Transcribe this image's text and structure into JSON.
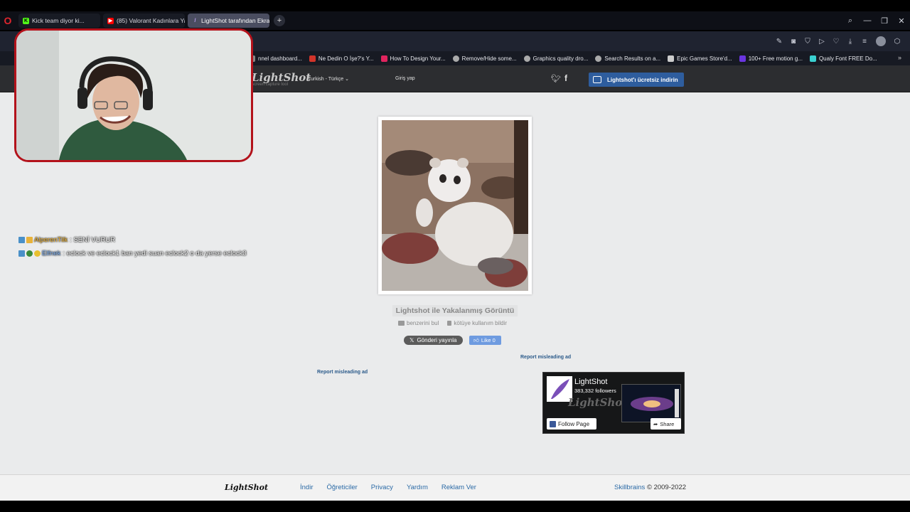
{
  "browser": {
    "tabs": [
      {
        "label": "Kick team diyor ki...",
        "icon": "kick-icon",
        "color": "#53fc18"
      },
      {
        "label": "(85) Valorant Kadınlara Ya...",
        "icon": "youtube-icon",
        "color": "#ff0000"
      },
      {
        "label": "LightShot tarafından Ekra...",
        "icon": "lightshot-feather-icon",
        "color": "#9b6cd9"
      }
    ],
    "bookmarks": [
      {
        "label": "nnel dashboard...",
        "color": "#888888"
      },
      {
        "label": "Ne Dedin O İşe?'s Y...",
        "color": "#d2342a"
      },
      {
        "label": "How To Design Your...",
        "color": "#e0245e"
      },
      {
        "label": "Remove/Hide some...",
        "color": "#aaaaaa"
      },
      {
        "label": "Graphics quality dro...",
        "color": "#aaaaaa"
      },
      {
        "label": "Search Results on a...",
        "color": "#aaaaaa"
      },
      {
        "label": "Epic Games Store'd...",
        "color": "#cccccc"
      },
      {
        "label": "100+ Free motion g...",
        "color": "#6a35e0"
      },
      {
        "label": "Qualy Font FREE Do...",
        "color": "#3ad0d0"
      }
    ]
  },
  "header": {
    "logo": "LightShot",
    "logo_sub": "screen capture tool",
    "language": "Turkish - Türkçe",
    "login": "Giriş yap",
    "download_button": "Lightshot'ı ücretsiz indirin"
  },
  "main": {
    "caption": "Lightshot ile Yakalanmış Görüntü",
    "find_similar": "benzerini bul",
    "report_abuse": "kötüye kullanım bildir",
    "post_button": "Gönderi yayınla",
    "like_button": "Like 0",
    "report_ad_1": "Report misleading ad",
    "report_ad_2": "Report misleading ad"
  },
  "facebook_widget": {
    "name": "LightShot",
    "followers": "383,332 followers",
    "brand": "LightShot",
    "follow_button": "Follow Page",
    "share_button": "Share"
  },
  "footer": {
    "logo": "LightShot",
    "links": [
      "İndir",
      "Öğreticiler",
      "Privacy",
      "Yardım",
      "Reklam Ver"
    ],
    "company": "Skillbrains",
    "copyright": "© 2009-2022"
  },
  "chat": [
    {
      "user": "AlperenTilk",
      "message": ": SENİ VURUR"
    },
    {
      "user": "Elfnek",
      "message": ": eclock ve eclock1 ban yedi suan eclock2 o da yerse eclock3"
    }
  ]
}
